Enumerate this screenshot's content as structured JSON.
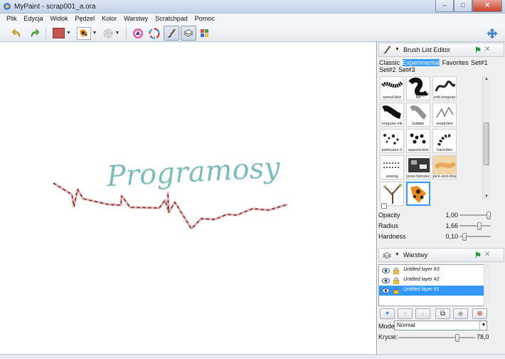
{
  "window": {
    "title": "MyPaint - scrap001_a.ora",
    "minimize": "–",
    "maximize": "□",
    "close": "✕"
  },
  "menu": [
    "Plik",
    "Edycja",
    "Widok",
    "Pędzel",
    "Kolor",
    "Warstwy",
    "Scratchpad",
    "Pomoc"
  ],
  "toolbar": {
    "icons": [
      "undo-icon",
      "redo-icon",
      "color-swatch",
      "brush-preset-icon",
      "settings-icon",
      "color-triangle-icon",
      "color-wheel-icon",
      "brush-editor-icon",
      "layers-icon",
      "color-palette-icon",
      "fullscreen-icon"
    ],
    "current_color": "#c6544b"
  },
  "canvas": {
    "text": "Programosy",
    "text_color": "#7dbcbc",
    "stroke_color": "#f2a8a8",
    "dash_color": "#3a3a3a"
  },
  "brush_panel": {
    "title": "Brush List Editor",
    "groups": [
      "Classic",
      "Experimental",
      "Favorites",
      "Set#1",
      "Set#2",
      "Set#3"
    ],
    "selected_group": "Experimental",
    "brushes": [
      "speed-blot",
      "fur",
      "soft-irregular",
      "irregular-ink",
      "bubble",
      "small-blot",
      "particules-3",
      "spaced-blot",
      "hard-blot",
      "sewing",
      "pixel-blender",
      "pick-and-drag",
      "",
      ""
    ],
    "sliders": [
      {
        "label": "Opacity",
        "value": "1,00",
        "level": 1.0
      },
      {
        "label": "Radius",
        "value": "1,66",
        "level": 0.66
      },
      {
        "label": "Hardness",
        "value": "0,10",
        "level": 0.1
      }
    ]
  },
  "layers_panel": {
    "title": "Warstwy",
    "layers": [
      "Untitled layer #3",
      "Untitled layer #2",
      "Untitled layer #1"
    ],
    "selected": "Untitled layer #1",
    "buttons": [
      "+",
      "↑",
      "↓",
      "⧉",
      "◆",
      "⊗"
    ],
    "mode_label": "Mode:",
    "mode_value": "Normal",
    "opacity_label": "Krycie:",
    "opacity_value": "78,0",
    "opacity_level": 0.78
  }
}
